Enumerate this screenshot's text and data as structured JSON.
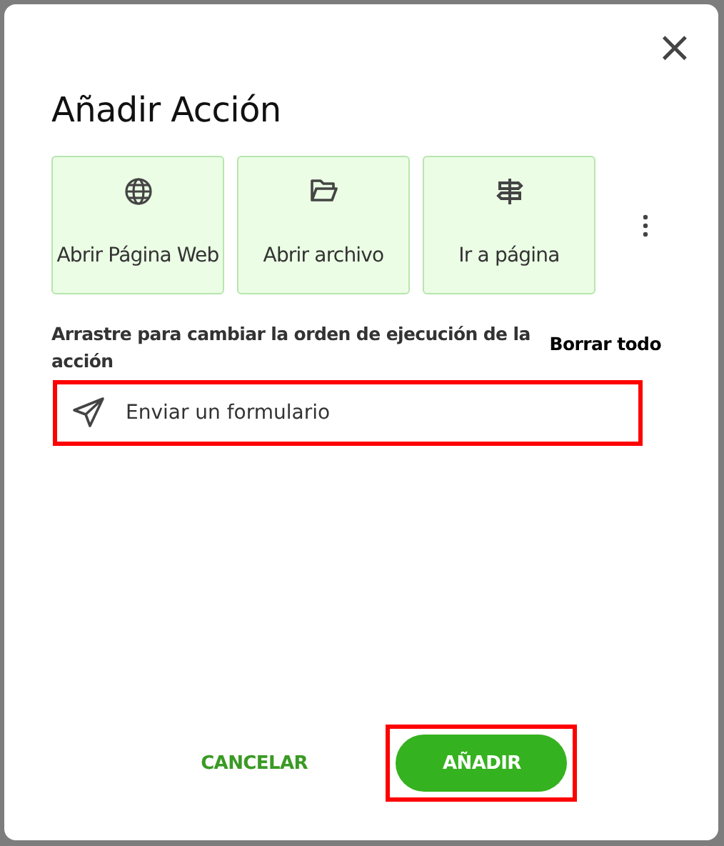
{
  "dialog": {
    "title": "Añadir Acción",
    "close": "×"
  },
  "action_types": [
    {
      "label": "Abrir Página Web",
      "kind": "globe"
    },
    {
      "label": "Abrir archivo",
      "kind": "folder"
    },
    {
      "label": "Ir a página",
      "kind": "signpost"
    }
  ],
  "instruction": "Arrastre para cambiar la orden de ejecución de la acción",
  "clear_all": "Borrar todo",
  "actions": [
    {
      "label": "Enviar un formulario",
      "kind": "send",
      "highlighted": true
    }
  ],
  "buttons": [
    {
      "label": "CANCELAR",
      "kind": "text",
      "highlighted": false
    },
    {
      "label": "AÑADIR",
      "kind": "primary",
      "highlighted": true
    }
  ]
}
